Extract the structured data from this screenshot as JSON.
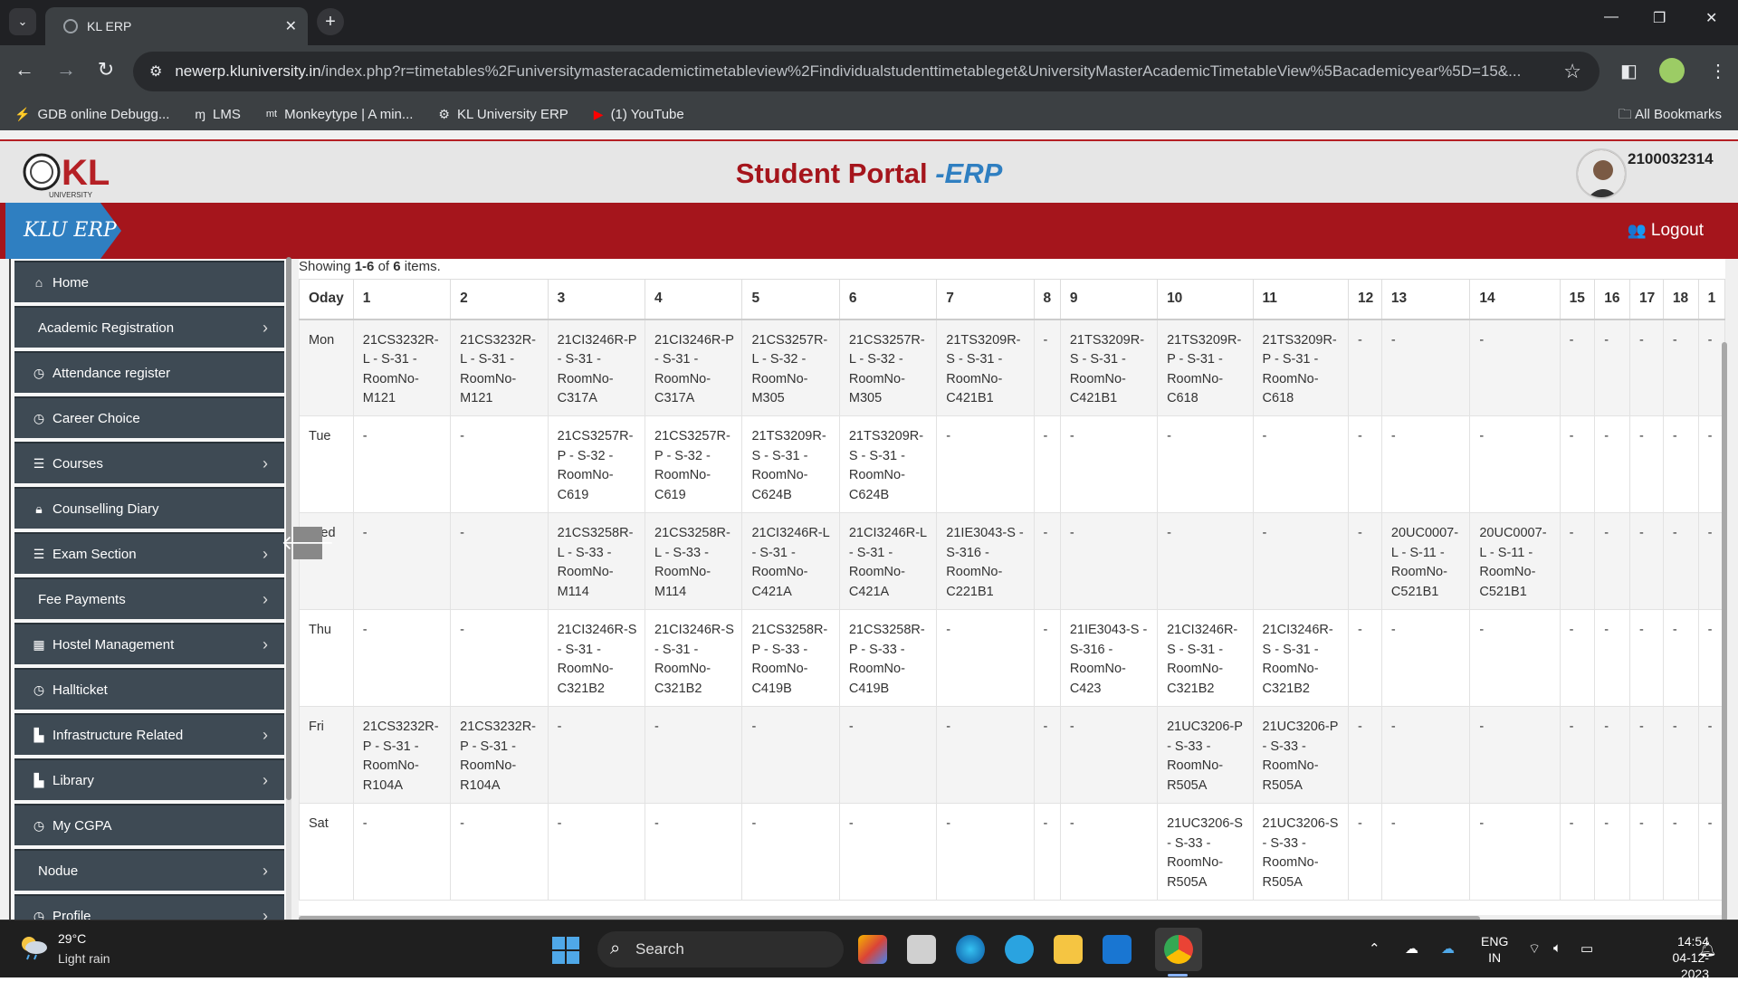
{
  "browser": {
    "tab_title": "KL ERP",
    "url_domain": "newerp.kluniversity.in",
    "url_path": "/index.php?r=timetables%2Funiversitymasteracademictimetableview%2Findividualstudenttimetableget&UniversityMasterAcademicTimetableView%5Bacademicyear%5D=15&...",
    "bookmarks": [
      "GDB online Debugg...",
      "LMS",
      "Monkeytype | A min...",
      "KL University ERP",
      "(1) YouTube"
    ],
    "all_bookmarks": "All Bookmarks"
  },
  "header": {
    "portal_title": "Student Portal ",
    "portal_title_suffix": "-ERP",
    "student_id": "2100032314",
    "brand_tag": "KLU ERP",
    "logout_label": "Logout"
  },
  "sidebar": {
    "items": [
      {
        "label": "Home",
        "icon": "home-icon",
        "chevron": false
      },
      {
        "label": "Academic Registration",
        "icon": "",
        "chevron": true
      },
      {
        "label": "Attendance register",
        "icon": "clock-icon",
        "chevron": false
      },
      {
        "label": "Career Choice",
        "icon": "clock-icon",
        "chevron": false
      },
      {
        "label": "Courses",
        "icon": "list-icon",
        "chevron": true
      },
      {
        "label": "Counselling Diary",
        "icon": "lock-icon",
        "chevron": false
      },
      {
        "label": "Exam Section",
        "icon": "list-icon",
        "chevron": true
      },
      {
        "label": "Fee Payments",
        "icon": "",
        "chevron": true
      },
      {
        "label": "Hostel Management",
        "icon": "building-icon",
        "chevron": true
      },
      {
        "label": "Hallticket",
        "icon": "clock-icon",
        "chevron": false
      },
      {
        "label": "Infrastructure Related",
        "icon": "chart-icon",
        "chevron": true
      },
      {
        "label": "Library",
        "icon": "chart-icon",
        "chevron": true
      },
      {
        "label": "My CGPA",
        "icon": "clock-icon",
        "chevron": false
      },
      {
        "label": "Nodue",
        "icon": "",
        "chevron": true
      },
      {
        "label": "Profile",
        "icon": "clock-icon",
        "chevron": true
      }
    ]
  },
  "summary": {
    "prefix": "Showing ",
    "range": "1-6",
    "of": " of ",
    "total": "6",
    "suffix": " items."
  },
  "timetable": {
    "headers": [
      "Oday",
      "1",
      "2",
      "3",
      "4",
      "5",
      "6",
      "7",
      "8",
      "9",
      "10",
      "11",
      "12",
      "13",
      "14",
      "15",
      "16",
      "17",
      "18",
      "1"
    ],
    "rows": [
      [
        "Mon",
        "21CS3232R-L - S-31 - RoomNo-M121",
        "21CS3232R-L - S-31 - RoomNo-M121",
        "21CI3246R-P - S-31 - RoomNo-C317A",
        "21CI3246R-P - S-31 - RoomNo-C317A",
        "21CS3257R-L - S-32 - RoomNo-M305",
        "21CS3257R-L - S-32 - RoomNo-M305",
        "21TS3209R-S - S-31 - RoomNo-C421B1",
        "-",
        "21TS3209R-S - S-31 - RoomNo-C421B1",
        "21TS3209R-P - S-31 - RoomNo-C618",
        "21TS3209R-P - S-31 - RoomNo-C618",
        "-",
        "-",
        "-",
        "-",
        "-",
        "-",
        "-",
        "-"
      ],
      [
        "Tue",
        "-",
        "-",
        "21CS3257R-P - S-32 - RoomNo-C619",
        "21CS3257R-P - S-32 - RoomNo-C619",
        "21TS3209R-S - S-31 - RoomNo-C624B",
        "21TS3209R-S - S-31 - RoomNo-C624B",
        "-",
        "-",
        "-",
        "-",
        "-",
        "-",
        "-",
        "-",
        "-",
        "-",
        "-",
        "-",
        "-"
      ],
      [
        "Wed",
        "-",
        "-",
        "21CS3258R-L - S-33 - RoomNo-M114",
        "21CS3258R-L - S-33 - RoomNo-M114",
        "21CI3246R-L - S-31 - RoomNo-C421A",
        "21CI3246R-L - S-31 - RoomNo-C421A",
        "21IE3043-S - S-316 - RoomNo-C221B1",
        "-",
        "-",
        "-",
        "-",
        "-",
        "20UC0007-L - S-11 - RoomNo-C521B1",
        "20UC0007-L - S-11 - RoomNo-C521B1",
        "-",
        "-",
        "-",
        "-",
        "-"
      ],
      [
        "Thu",
        "-",
        "-",
        "21CI3246R-S - S-31 - RoomNo-C321B2",
        "21CI3246R-S - S-31 - RoomNo-C321B2",
        "21CS3258R-P - S-33 - RoomNo-C419B",
        "21CS3258R-P - S-33 - RoomNo-C419B",
        "-",
        "-",
        "21IE3043-S - S-316 - RoomNo-C423",
        "21CI3246R-S - S-31 - RoomNo-C321B2",
        "21CI3246R-S - S-31 - RoomNo-C321B2",
        "-",
        "-",
        "-",
        "-",
        "-",
        "-",
        "-",
        "-"
      ],
      [
        "Fri",
        "21CS3232R-P - S-31 - RoomNo-R104A",
        "21CS3232R-P - S-31 - RoomNo-R104A",
        "-",
        "-",
        "-",
        "-",
        "-",
        "-",
        "-",
        "21UC3206-P - S-33 - RoomNo-R505A",
        "21UC3206-P - S-33 - RoomNo-R505A",
        "-",
        "-",
        "-",
        "-",
        "-",
        "-",
        "-",
        "-"
      ],
      [
        "Sat",
        "-",
        "-",
        "-",
        "-",
        "-",
        "-",
        "-",
        "-",
        "-",
        "21UC3206-S - S-33 - RoomNo-R505A",
        "21UC3206-S - S-33 - RoomNo-R505A",
        "-",
        "-",
        "-",
        "-",
        "-",
        "-",
        "-",
        "-"
      ]
    ]
  },
  "taskbar": {
    "temperature": "29°C",
    "weather": "Light rain",
    "search_placeholder": "Search",
    "lang_line1": "ENG",
    "lang_line2": "IN",
    "time": "14:54",
    "date": "04-12-2023"
  },
  "colors": {
    "brand_red": "#a5151c",
    "brand_blue": "#2f7fc1",
    "sidebar_bg": "#3e4a54"
  }
}
